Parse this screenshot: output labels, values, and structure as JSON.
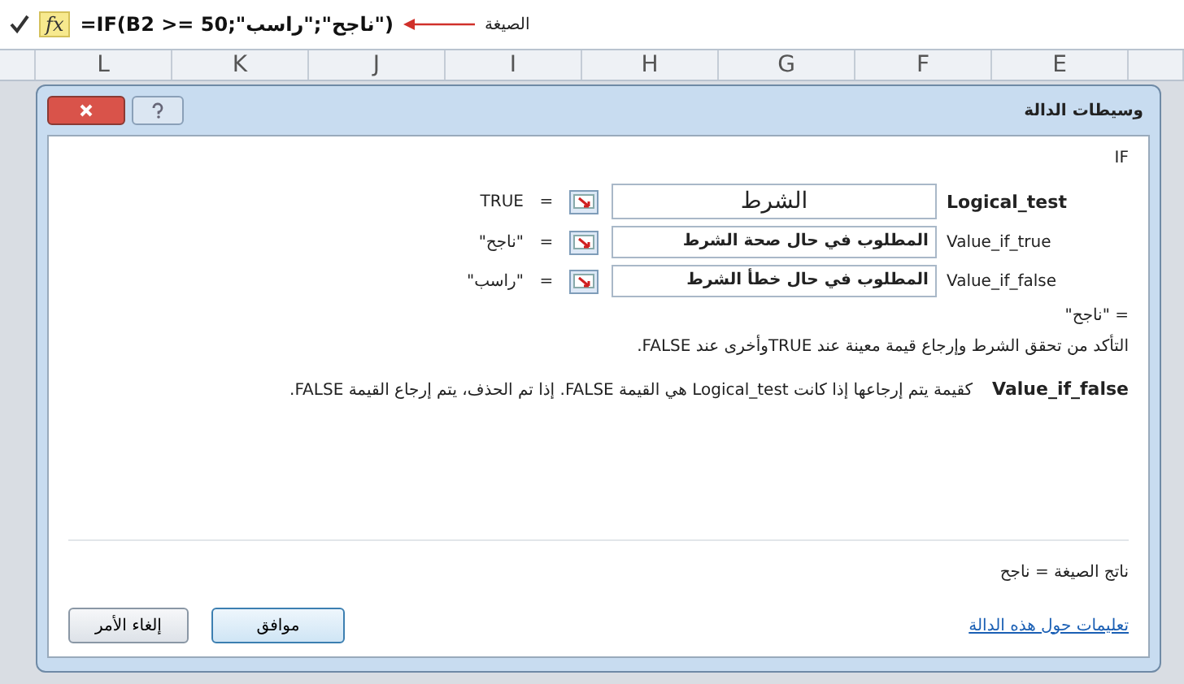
{
  "formula_bar": {
    "fx_label": "fx",
    "formula": "=IF(B2 >= 50;\"ناجح\";\"راسب\")",
    "annotation": "الصيغة"
  },
  "columns": [
    "E",
    "F",
    "G",
    "H",
    "I",
    "J",
    "K",
    "L"
  ],
  "dialog": {
    "title": "وسيطات الدالة",
    "function_name": "IF",
    "arguments": [
      {
        "label": "Logical_test",
        "bold": true,
        "value": "الشرط",
        "equals": "=",
        "result": "TRUE"
      },
      {
        "label": "Value_if_true",
        "bold": false,
        "value": "المطلوب في حال صحة الشرط",
        "equals": "=",
        "result": "\"ناجح\""
      },
      {
        "label": "Value_if_false",
        "bold": false,
        "value": "المطلوب في حال خطأ الشرط",
        "equals": "=",
        "result": "\"راسب\""
      }
    ],
    "result": "\"ناجح\"  =",
    "description": "التأكد من تحقق الشرط وإرجاع قيمة معينة عند TRUEوأخرى عند FALSE.",
    "argument_help": {
      "name": "Value_if_false",
      "text": "كقيمة يتم إرجاعها إذا كانت Logical_test هي القيمة FALSE. إذا تم الحذف، يتم إرجاع القيمة FALSE."
    },
    "formula_result": "ناتج الصيغة = ناجح",
    "help_link": "تعليمات حول هذه الدالة",
    "buttons": [
      "موافق",
      "إلغاء الأمر"
    ]
  }
}
